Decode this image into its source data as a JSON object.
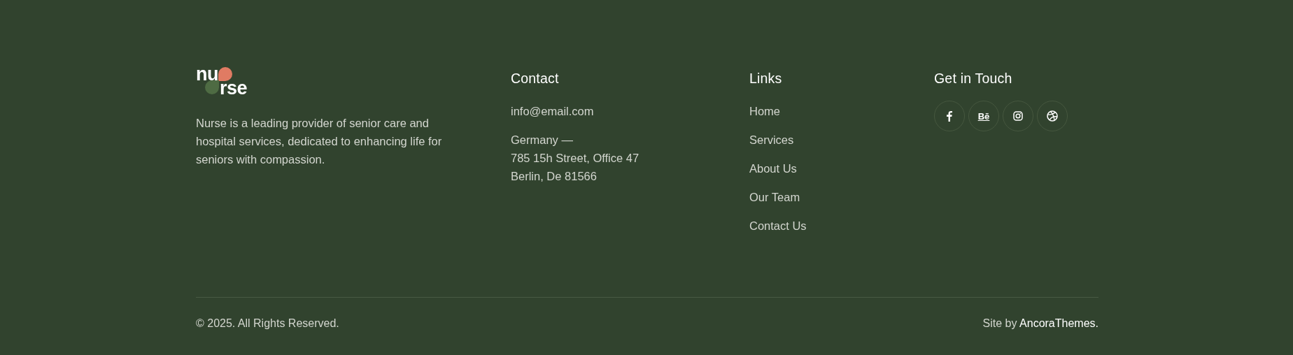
{
  "brand": {
    "logo_top": "nu",
    "logo_bottom": "rse",
    "description": "Nurse is a leading provider of senior care and hospital services, dedicated to enhancing life for seniors with compassion."
  },
  "contact": {
    "title": "Contact",
    "email": "info@email.com",
    "address": [
      "Germany —",
      "785 15h Street, Office 47",
      "Berlin, De 81566"
    ]
  },
  "links": {
    "title": "Links",
    "items": [
      "Home",
      "Services",
      "About Us",
      "Our Team",
      "Contact Us"
    ]
  },
  "get_in_touch": {
    "title": "Get in Touch",
    "socials": [
      {
        "kind": "facebook"
      },
      {
        "kind": "behance",
        "label": "Bē"
      },
      {
        "kind": "instagram"
      },
      {
        "kind": "dribbble"
      }
    ]
  },
  "bottom": {
    "copyright": "© 2025. All Rights Reserved.",
    "credit_prefix": "Site by",
    "credit_link": "AncoraThemes."
  }
}
